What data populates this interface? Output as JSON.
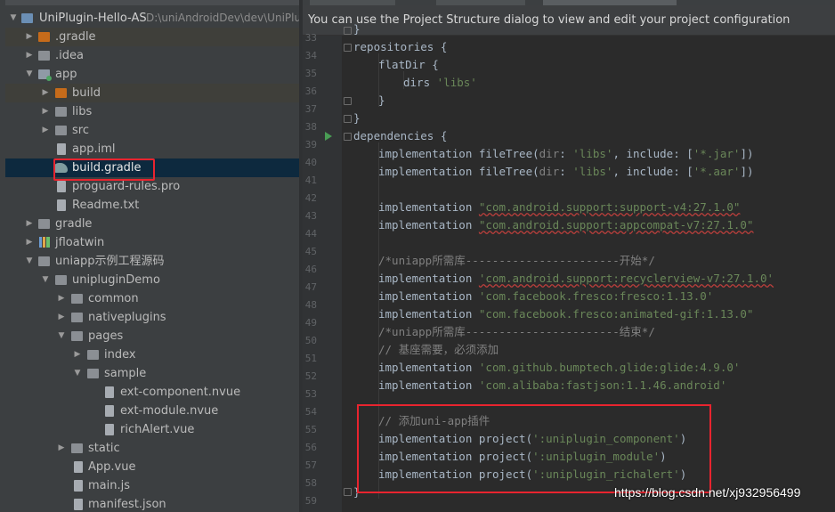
{
  "project": {
    "root_name": "UniPlugin-Hello-AS",
    "root_path": "D:\\uniAndroidDev\\dev\\UniPlu",
    "items": [
      {
        "label": ".gradle"
      },
      {
        "label": ".idea"
      },
      {
        "label": "app"
      },
      {
        "label": "build"
      },
      {
        "label": "libs"
      },
      {
        "label": "src"
      },
      {
        "label": "app.iml"
      },
      {
        "label": "build.gradle"
      },
      {
        "label": "proguard-rules.pro"
      },
      {
        "label": "Readme.txt"
      },
      {
        "label": "gradle"
      },
      {
        "label": "jfloatwin"
      },
      {
        "label": "uniapp示例工程源码"
      },
      {
        "label": "unipluginDemo"
      },
      {
        "label": "common"
      },
      {
        "label": "nativeplugins"
      },
      {
        "label": "pages"
      },
      {
        "label": "index"
      },
      {
        "label": "sample"
      },
      {
        "label": "ext-component.nvue"
      },
      {
        "label": "ext-module.nvue"
      },
      {
        "label": "richAlert.vue"
      },
      {
        "label": "static"
      },
      {
        "label": "App.vue"
      },
      {
        "label": "main.js"
      },
      {
        "label": "manifest.json"
      }
    ]
  },
  "editor": {
    "banner": "You can use the Project Structure dialog to view and edit your project configuration",
    "line_numbers": [
      "33",
      "34",
      "35",
      "36",
      "37",
      "38",
      "39",
      "40",
      "41",
      "42",
      "43",
      "44",
      "45",
      "46",
      "47",
      "48",
      "49",
      "50",
      "51",
      "52",
      "53",
      "54",
      "55",
      "56",
      "57",
      "58",
      "59"
    ],
    "code": {
      "l33": "}",
      "l34a": "repositories {",
      "l35a": "flatDir {",
      "l36a": "dirs ",
      "l36b": "'libs'",
      "l37": "}",
      "l38": "}",
      "l39": "dependencies {",
      "impl": "implementation",
      "filetree": "fileTree",
      "dir_kw": "dir",
      "include_kw": "include",
      "libs_str": "'libs'",
      "jar_str": "'*.jar'",
      "aar_str": "'*.aar'",
      "l43s": "\"com.android.support:support-v4:27.1.0\"",
      "l44s": "\"com.android.support:appcompat-v7:27.1.0\"",
      "l46c": "/*uniapp所需库-----------------------开始*/",
      "l47s": "'com.android.support:recyclerview-v7:27.1.0'",
      "l48s": "'com.facebook.fresco:fresco:1.13.0'",
      "l49s": "\"com.facebook.fresco:animated-gif:1.13.0\"",
      "l50c": "/*uniapp所需库-----------------------结束*/",
      "l51c": "// 基座需要，必须添加",
      "l52s": "'com.github.bumptech.glide:glide:4.9.0'",
      "l53s": "'com.alibaba:fastjson:1.1.46.android'",
      "l55c": "// 添加uni-app插件",
      "project_fn": "project",
      "l56s": "':uniplugin_component'",
      "l57s": "':uniplugin_module'",
      "l58s": "':uniplugin_richalert'",
      "l59": "}"
    }
  },
  "watermark": "https://blog.csdn.net/xj932956499",
  "colors": {
    "selection": "#0d293e",
    "highlight_box": "#e8242f",
    "string": "#6a8759",
    "comment": "#808080"
  }
}
